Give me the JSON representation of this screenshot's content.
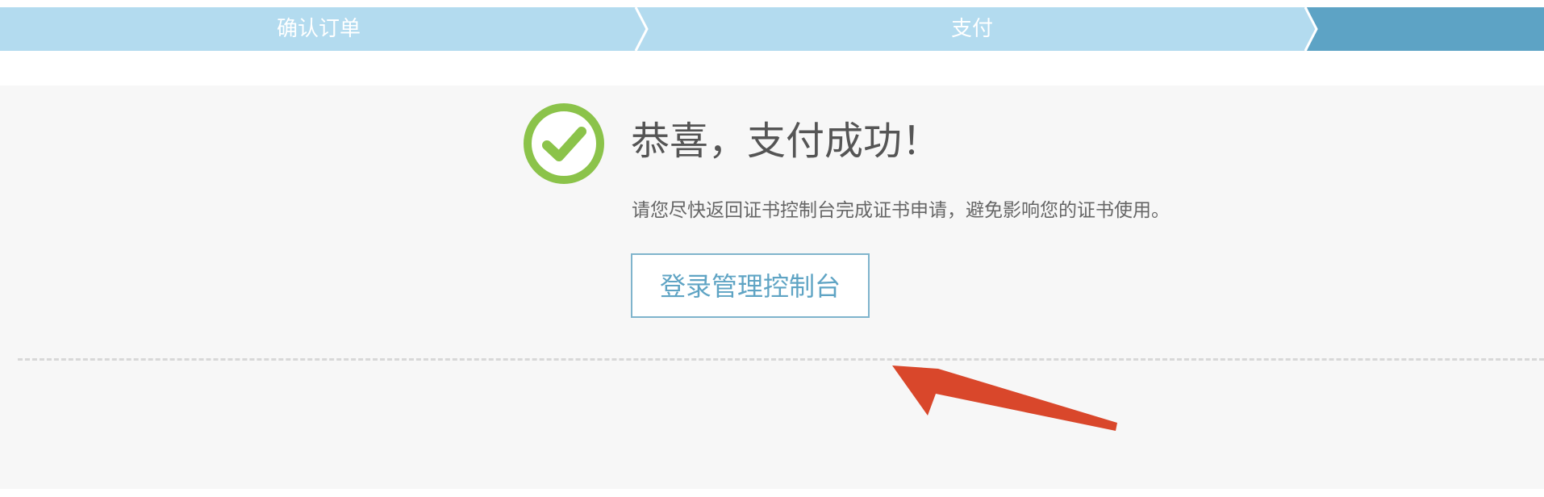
{
  "progress": {
    "steps": [
      {
        "label": "确认订单",
        "status": "completed"
      },
      {
        "label": "支付",
        "status": "completed"
      },
      {
        "label": "",
        "status": "current"
      }
    ],
    "colors": {
      "completed": "#b3dbef",
      "current": "#5da3c5"
    }
  },
  "result": {
    "icon": "check-circle-icon",
    "title": "恭喜，支付成功！",
    "message": "请您尽快返回证书控制台完成证书申请，避免影响您的证书使用。",
    "button_label": "登录管理控制台",
    "icon_color": "#8bc34a"
  },
  "annotation": {
    "icon": "red-arrow-annotation",
    "color": "#d9472b"
  }
}
